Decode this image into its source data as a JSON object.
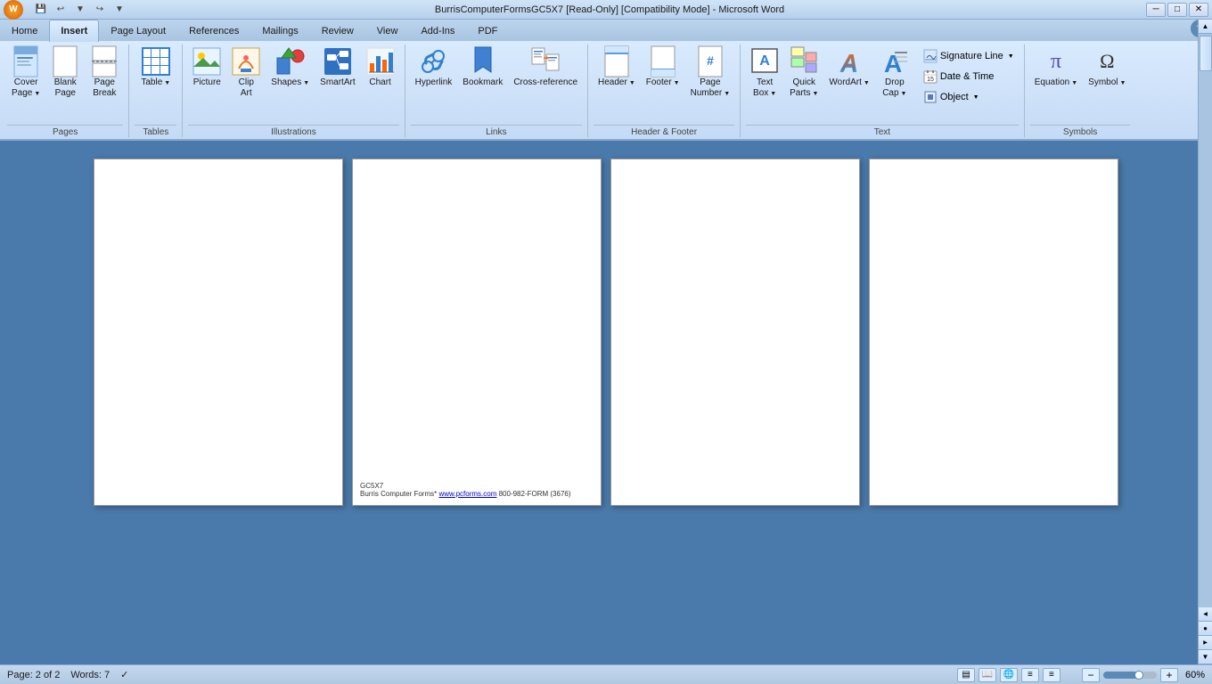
{
  "titlebar": {
    "title": "BurrisComputerFormsGC5X7 [Read-Only] [Compatibility Mode] - Microsoft Word",
    "minimize": "─",
    "restore": "□",
    "close": "✕"
  },
  "quickaccess": {
    "save": "💾",
    "undo": "↩",
    "redo": "↪",
    "more": "▼"
  },
  "ribbon": {
    "tabs": [
      "Home",
      "Insert",
      "Page Layout",
      "References",
      "Mailings",
      "Review",
      "View",
      "Add-Ins",
      "PDF"
    ],
    "active_tab": "Insert",
    "groups": {
      "pages": {
        "label": "Pages",
        "buttons": [
          "Cover Page",
          "Blank Page",
          "Page Break"
        ]
      },
      "tables": {
        "label": "Tables",
        "buttons": [
          "Table"
        ]
      },
      "illustrations": {
        "label": "Illustrations",
        "buttons": [
          "Picture",
          "Clip Art",
          "Shapes",
          "SmartArt",
          "Chart"
        ]
      },
      "links": {
        "label": "Links",
        "buttons": [
          "Hyperlink",
          "Bookmark",
          "Cross-reference"
        ]
      },
      "header_footer": {
        "label": "Header & Footer",
        "buttons": [
          "Header",
          "Footer",
          "Page Number"
        ]
      },
      "text": {
        "label": "Text",
        "buttons": [
          "Text Box",
          "Quick Parts",
          "WordArt",
          "Drop Cap"
        ]
      },
      "text_right": {
        "buttons": [
          "Signature Line",
          "Date & Time",
          "Object"
        ]
      },
      "symbols": {
        "label": "Symbols",
        "buttons": [
          "Equation",
          "Symbol"
        ]
      }
    }
  },
  "pages": [
    {
      "id": 1,
      "has_footer": false,
      "footer_text": ""
    },
    {
      "id": 2,
      "has_footer": true,
      "footer_code": "GC5X7",
      "footer_text": "Burris Computer Forms*",
      "footer_url": "www.pcforms.com",
      "footer_extra": " 800-982-FORM (3676)"
    },
    {
      "id": 3,
      "has_footer": false,
      "footer_text": ""
    },
    {
      "id": 4,
      "has_footer": false,
      "footer_text": ""
    }
  ],
  "statusbar": {
    "page": "Page: 2 of 2",
    "words": "Words: 7",
    "zoom": "60%"
  }
}
